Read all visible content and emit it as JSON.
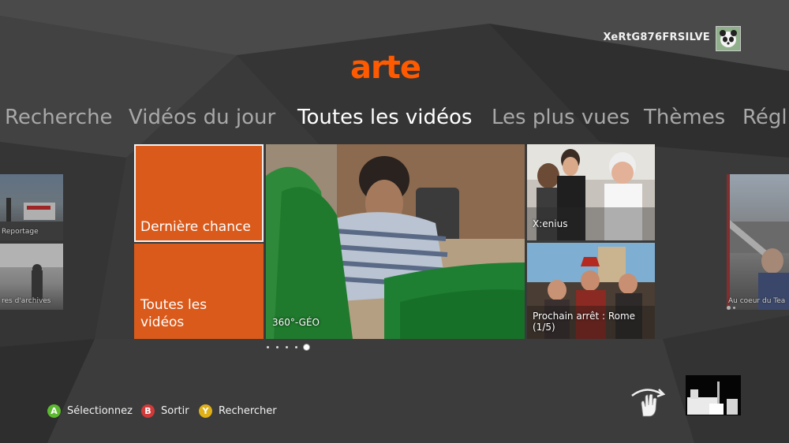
{
  "header": {
    "gamertag": "XeRtG876FRSILVE",
    "avatar_icon": "panda-avatar-icon",
    "logo_text": "arte",
    "logo_color": "#ff5a00"
  },
  "nav": {
    "tabs": [
      {
        "label": "Recherche",
        "active": false
      },
      {
        "label": "Vidéos du jour",
        "active": false
      },
      {
        "label": "Toutes les vidéos",
        "active": true
      },
      {
        "label": "Les plus vues",
        "active": false
      },
      {
        "label": "Thèmes",
        "active": false
      },
      {
        "label": "Régl",
        "active": false
      }
    ]
  },
  "tiles": {
    "derniere_chance": "Dernière chance",
    "toutes_les_videos_line1": "Toutes les",
    "toutes_les_videos_line2": "vidéos",
    "geo": "360°-GÉO",
    "xenius": "X:enius",
    "prochain_line1": "Prochain arrêt : Rome",
    "prochain_line2": "(1/5)"
  },
  "side_left": {
    "top_label": "Reportage",
    "bottom_label": "res d'archives"
  },
  "side_right": {
    "bottom_label": "Au coeur du Tea"
  },
  "pager": {
    "count": 5,
    "active_index": 4
  },
  "hints": [
    {
      "button": "A",
      "color": "#5cb930",
      "label": "Sélectionnez"
    },
    {
      "button": "B",
      "color": "#d23a3a",
      "label": "Sortir"
    },
    {
      "button": "Y",
      "color": "#e0b018",
      "label": "Rechercher"
    }
  ],
  "colors": {
    "accent_orange": "#d95a1b",
    "background": "#3a3a3a"
  },
  "icons": {
    "gesture": "hand-swipe-icon",
    "kinect": "kinect-camera-view"
  }
}
